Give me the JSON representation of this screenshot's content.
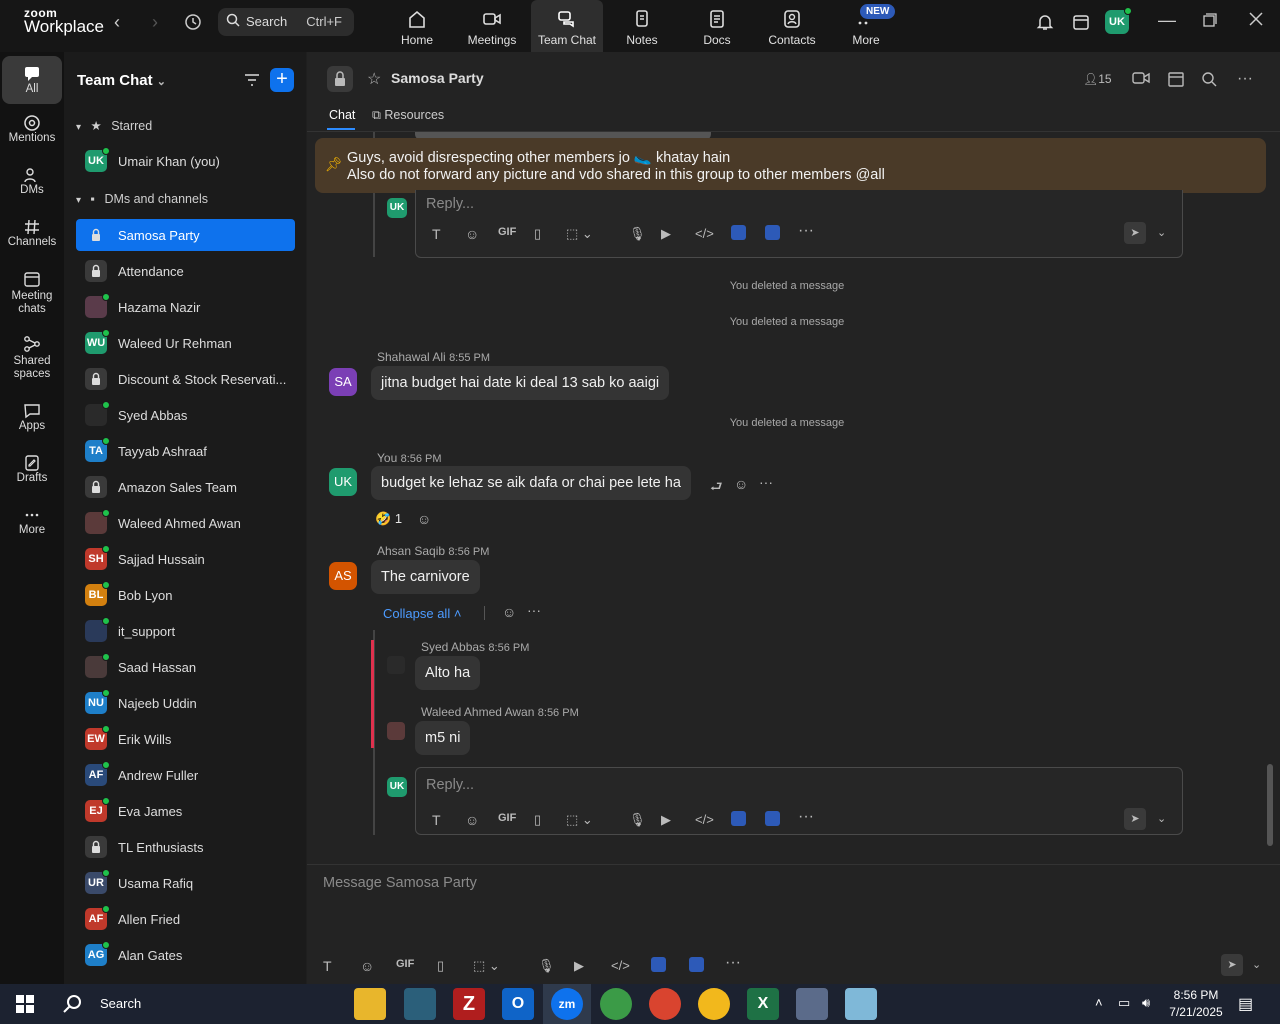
{
  "app": {
    "brand_small": "zoom",
    "brand_large": "Workplace"
  },
  "topbar": {
    "search_label": "Search",
    "search_shortcut": "Ctrl+F",
    "nav": [
      {
        "label": "Home",
        "icon": "home-icon"
      },
      {
        "label": "Meetings",
        "icon": "video-icon"
      },
      {
        "label": "Team Chat",
        "icon": "chat-icon"
      },
      {
        "label": "Notes",
        "icon": "notes-icon"
      },
      {
        "label": "Docs",
        "icon": "docs-icon"
      },
      {
        "label": "Contacts",
        "icon": "contacts-icon"
      },
      {
        "label": "More",
        "icon": "more-icon"
      }
    ],
    "new_badge": "NEW",
    "user_initials": "UK"
  },
  "rail": [
    {
      "label": "All",
      "icon": "chat-bubble-icon"
    },
    {
      "label": "Mentions",
      "icon": "at-icon"
    },
    {
      "label": "DMs",
      "icon": "people-icon"
    },
    {
      "label": "Channels",
      "icon": "hash-icon"
    },
    {
      "label": "Meeting chats",
      "icon": "calendar-icon"
    },
    {
      "label": "Shared spaces",
      "icon": "share-icon"
    },
    {
      "label": "Apps",
      "icon": "apps-icon"
    },
    {
      "label": "Drafts",
      "icon": "drafts-icon"
    },
    {
      "label": "More",
      "icon": "ellipsis-icon"
    }
  ],
  "sidebar": {
    "title": "Team Chat",
    "starred_label": "Starred",
    "starred": [
      {
        "name": "Umair Khan (you)",
        "initials": "UK",
        "color": "#1f9b6e"
      }
    ],
    "dms_label": "DMs and channels",
    "items": [
      {
        "name": "Samosa Party",
        "initials": "",
        "color": "",
        "locked": true
      },
      {
        "name": "Attendance",
        "initials": "",
        "color": "#3a3a3a",
        "locked": true
      },
      {
        "name": "Hazama Nazir",
        "initials": "",
        "color": "#5a3b4a"
      },
      {
        "name": "Waleed Ur Rehman",
        "initials": "WU",
        "color": "#1f9b6e"
      },
      {
        "name": "Discount & Stock Reservati...",
        "initials": "",
        "color": "#3a3a3a",
        "locked": true
      },
      {
        "name": "Syed Abbas",
        "initials": "",
        "color": "#2a2a2a"
      },
      {
        "name": "Tayyab Ashraaf",
        "initials": "TA",
        "color": "#1e7fc9"
      },
      {
        "name": "Amazon Sales Team",
        "initials": "",
        "color": "#3a3a3a",
        "locked": true
      },
      {
        "name": "Waleed Ahmed Awan",
        "initials": "",
        "color": "#5b3a3a"
      },
      {
        "name": "Sajjad Hussain",
        "initials": "SH",
        "color": "#c0392b"
      },
      {
        "name": "Bob Lyon",
        "initials": "BL",
        "color": "#d3800f"
      },
      {
        "name": "it_support",
        "initials": "",
        "color": "#2a3a5a"
      },
      {
        "name": "Saad Hassan",
        "initials": "",
        "color": "#4a3a3a"
      },
      {
        "name": "Najeeb Uddin",
        "initials": "NU",
        "color": "#1e7fc9"
      },
      {
        "name": "Erik Wills",
        "initials": "EW",
        "color": "#c0392b"
      },
      {
        "name": "Andrew Fuller",
        "initials": "AF",
        "color": "#2a4a7a"
      },
      {
        "name": "Eva James",
        "initials": "EJ",
        "color": "#c0392b"
      },
      {
        "name": "TL Enthusiasts",
        "initials": "",
        "color": "#3a3a3a",
        "locked": true
      },
      {
        "name": "Usama Rafiq",
        "initials": "UR",
        "color": "#3a4a6a"
      },
      {
        "name": "Allen Fried",
        "initials": "AF",
        "color": "#c0392b"
      },
      {
        "name": "Alan Gates",
        "initials": "AG",
        "color": "#1e7fc9"
      }
    ]
  },
  "channel": {
    "title": "Samosa Party",
    "member_count": "15",
    "tabs": [
      {
        "label": "Chat"
      },
      {
        "label": "Resources"
      }
    ],
    "pinned_line1": "Guys, avoid disrespecting other members jo 🥿 khatay hain",
    "pinned_line2": "Also do not forward any picture and vdo shared in this group to other members @all"
  },
  "messages": {
    "reply_placeholder": "Reply...",
    "deleted_1": "You deleted a message",
    "deleted_2": "You deleted a message",
    "deleted_3": "You deleted a message",
    "m1_name": "Shahawal Ali",
    "m1_time": "8:55 PM",
    "m1_text": "jitna budget hai date ki deal 13 sab ko aaigi",
    "m1_initials": "SA",
    "m2_name": "You",
    "m2_time": "8:56 PM",
    "m2_text": "budget ke lehaz se aik dafa or chai pee lete ha",
    "m2_initials": "UK",
    "m2_reaction": "🤣",
    "m2_reaction_count": "1",
    "m3_name": "Ahsan Saqib",
    "m3_time": "8:56 PM",
    "m3_text": "The carnivore",
    "m3_initials": "AS",
    "collapse_label": "Collapse all",
    "r1_name": "Syed Abbas",
    "r1_time": "8:56 PM",
    "r1_text": "Alto ha",
    "r2_name": "Waleed Ahmed Awan",
    "r2_time": "8:56 PM",
    "r2_text": "m5 ni",
    "reply_avatar": "UK"
  },
  "composer": {
    "placeholder": "Message Samosa Party"
  },
  "taskbar": {
    "search_label": "Search",
    "time": "8:56 PM",
    "date": "7/21/2025"
  }
}
